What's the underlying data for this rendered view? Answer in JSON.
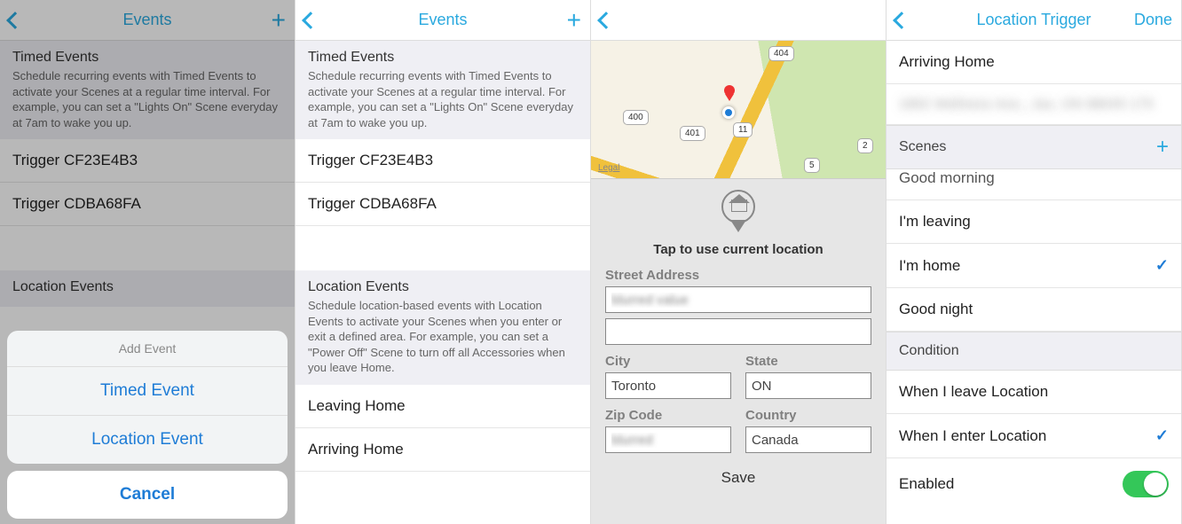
{
  "screen1": {
    "title": "Events",
    "timed_header": "Timed Events",
    "timed_desc": "Schedule recurring events with Timed Events to activate your Scenes at a regular time interval. For example, you can set a \"Lights On\" Scene everyday at 7am to wake you up.",
    "triggers": [
      "Trigger CF23E4B3",
      "Trigger CDBA68FA"
    ],
    "location_header": "Location Events",
    "sheet_title": "Add Event",
    "sheet_opt1": "Timed Event",
    "sheet_opt2": "Location Event",
    "sheet_cancel": "Cancel"
  },
  "screen2": {
    "title": "Events",
    "timed_header": "Timed Events",
    "timed_desc": "Schedule recurring events with Timed Events to activate your Scenes at a regular time interval. For example, you can set a \"Lights On\" Scene everyday at 7am to wake you up.",
    "triggers": [
      "Trigger CF23E4B3",
      "Trigger CDBA68FA"
    ],
    "location_header": "Location Events",
    "location_desc": "Schedule location-based events with Location Events to activate your Scenes when you enter or exit a defined area. For example, you can set a \"Power Off\" Scene to turn off all Accessories when you leave Home.",
    "location_triggers": [
      "Leaving Home",
      "Arriving Home"
    ]
  },
  "screen3": {
    "map_badges": [
      "404",
      "400",
      "401",
      "11",
      "5",
      "2"
    ],
    "legal": "Legal",
    "pin_caption": "Tap to use current location",
    "label_street": "Street Address",
    "label_city": "City",
    "label_state": "State",
    "label_zip": "Zip Code",
    "label_country": "Country",
    "val_city": "Toronto",
    "val_state": "ON",
    "val_country": "Canada",
    "save": "Save"
  },
  "screen4": {
    "title": "Location Trigger",
    "done": "Done",
    "name_row": "Arriving Home",
    "address_row_mask": "1892 Wellness Ave., Jax, ON 88045 175",
    "scenes_header": "Scenes",
    "scene_partial": "Good morning",
    "scenes": [
      "I'm leaving",
      "I'm home",
      "Good night"
    ],
    "scene_checked": "I'm home",
    "condition_header": "Condition",
    "conditions": [
      "When I leave Location",
      "When I enter Location"
    ],
    "condition_checked": "When I enter Location",
    "enabled_label": "Enabled"
  }
}
